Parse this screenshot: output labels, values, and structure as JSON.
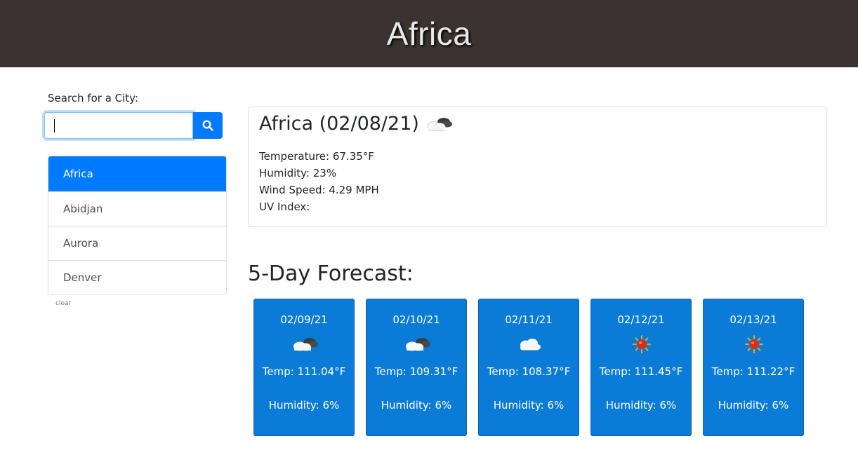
{
  "header": {
    "title": "Africa"
  },
  "search": {
    "label": "Search for a City:",
    "value": "",
    "placeholder": ""
  },
  "search_button_icon": "search-icon",
  "cities": [
    {
      "label": "Africa",
      "active": true
    },
    {
      "label": "Abidjan",
      "active": false
    },
    {
      "label": "Aurora",
      "active": false
    },
    {
      "label": "Denver",
      "active": false
    }
  ],
  "clear_label": "clear",
  "current": {
    "title": "Africa (02/08/21)",
    "icon": "cloudy-icon",
    "temperature": "Temperature: 67.35°F",
    "humidity": "Humidity: 23%",
    "wind": "Wind Speed: 4.29 MPH",
    "uv": "UV Index:"
  },
  "forecast_heading": "5-Day Forecast:",
  "forecast": [
    {
      "date": "02/09/21",
      "icon": "cloudy-icon",
      "temp": "Temp: 111.04°F",
      "humidity": "Humidity: 6%"
    },
    {
      "date": "02/10/21",
      "icon": "cloudy-icon",
      "temp": "Temp: 109.31°F",
      "humidity": "Humidity: 6%"
    },
    {
      "date": "02/11/21",
      "icon": "cloud-icon",
      "temp": "Temp: 108.37°F",
      "humidity": "Humidity: 6%"
    },
    {
      "date": "02/12/21",
      "icon": "sun-icon",
      "temp": "Temp: 111.45°F",
      "humidity": "Humidity: 6%"
    },
    {
      "date": "02/13/21",
      "icon": "sun-icon",
      "temp": "Temp: 111.22°F",
      "humidity": "Humidity: 6%"
    }
  ],
  "colors": {
    "header_bg": "#3b3331",
    "accent": "#007bff",
    "forecast_bg": "#0a7bd6"
  }
}
